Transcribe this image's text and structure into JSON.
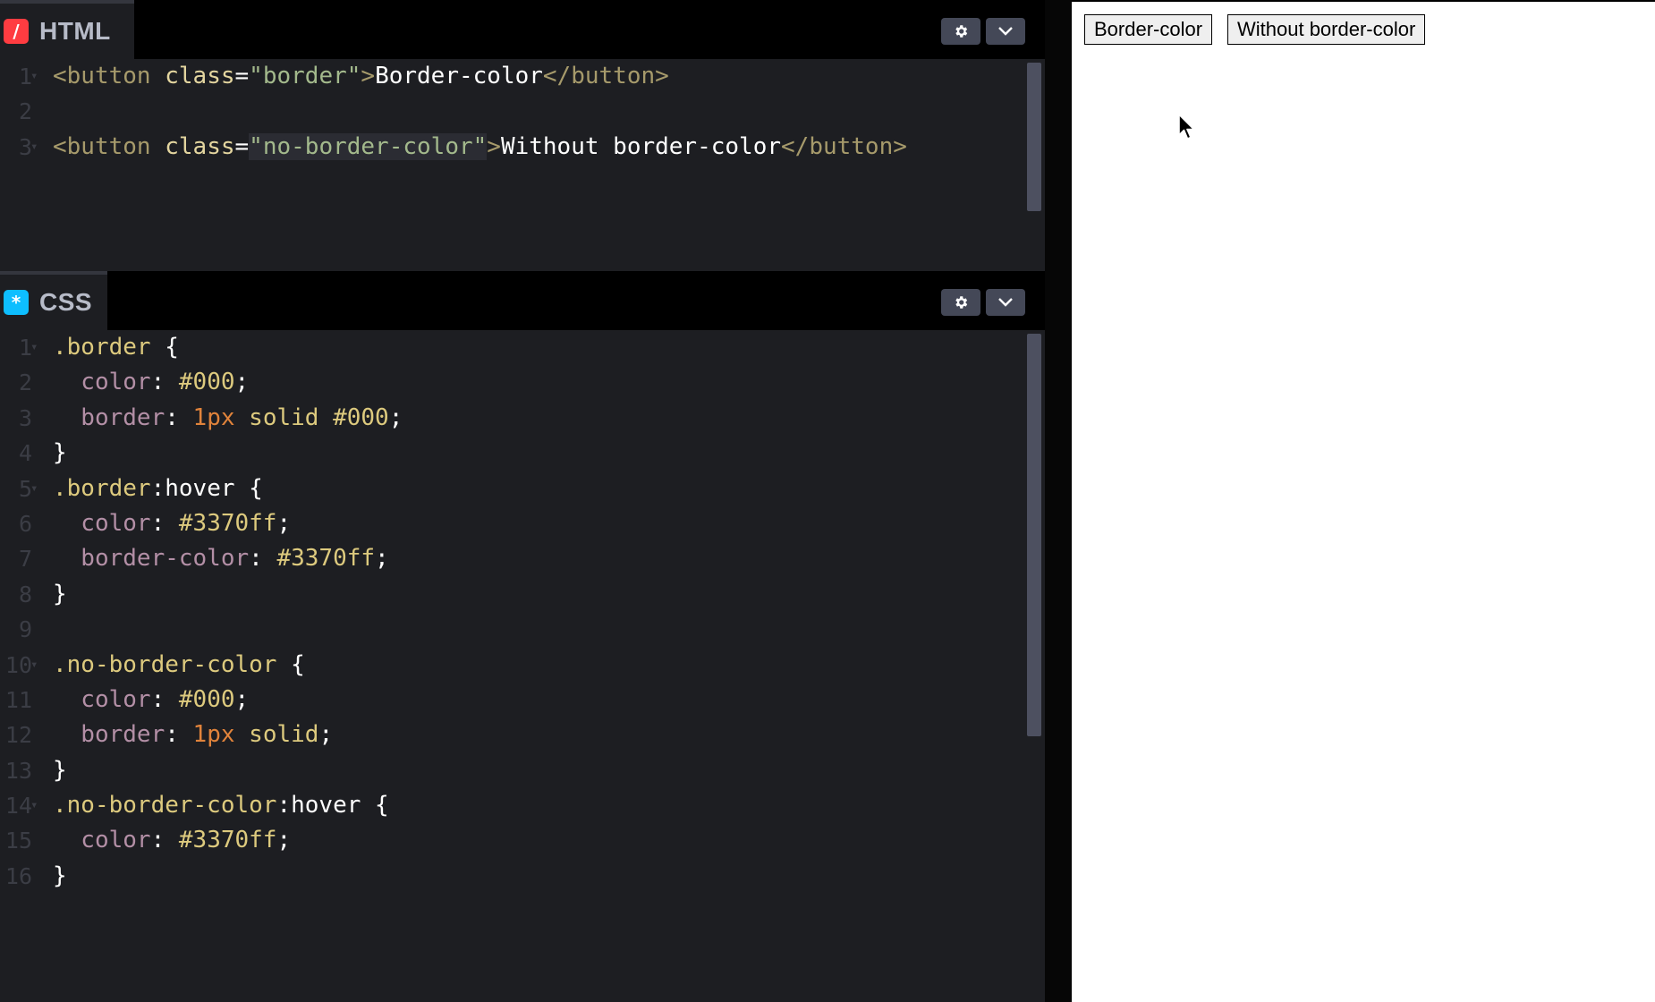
{
  "html_panel": {
    "title": "HTML",
    "icon": "/",
    "lines": [
      {
        "n": "1",
        "fold": true,
        "tokens": [
          {
            "t": "<button ",
            "c": "tag"
          },
          {
            "t": "class",
            "c": "attr"
          },
          {
            "t": "=",
            "c": "punc"
          },
          {
            "t": "\"border\"",
            "c": "str"
          },
          {
            "t": ">",
            "c": "tag"
          },
          {
            "t": "Border-color",
            "c": "txt"
          },
          {
            "t": "</button>",
            "c": "tag"
          }
        ]
      },
      {
        "n": "2",
        "fold": false,
        "tokens": []
      },
      {
        "n": "3",
        "fold": true,
        "tokens": [
          {
            "t": "<button ",
            "c": "tag"
          },
          {
            "t": "class",
            "c": "attr"
          },
          {
            "t": "=",
            "c": "punc"
          },
          {
            "t": "\"no-border-color\"",
            "c": "str",
            "hl": true
          },
          {
            "t": ">",
            "c": "tag"
          },
          {
            "t": "Without border-color",
            "c": "txt"
          },
          {
            "t": "</button>",
            "c": "tag"
          }
        ]
      }
    ]
  },
  "css_panel": {
    "title": "CSS",
    "icon": "*",
    "lines": [
      {
        "n": "1",
        "fold": true,
        "tokens": [
          {
            "t": ".border",
            "c": "sel"
          },
          {
            "t": " {",
            "c": "punc"
          }
        ]
      },
      {
        "n": "2",
        "fold": false,
        "tokens": [
          {
            "t": "  color",
            "c": "prop"
          },
          {
            "t": ": ",
            "c": "punc"
          },
          {
            "t": "#000",
            "c": "val"
          },
          {
            "t": ";",
            "c": "punc"
          }
        ]
      },
      {
        "n": "3",
        "fold": false,
        "tokens": [
          {
            "t": "  border",
            "c": "prop"
          },
          {
            "t": ": ",
            "c": "punc"
          },
          {
            "t": "1px",
            "c": "num"
          },
          {
            "t": " solid ",
            "c": "val"
          },
          {
            "t": "#000",
            "c": "val"
          },
          {
            "t": ";",
            "c": "punc"
          }
        ]
      },
      {
        "n": "4",
        "fold": false,
        "tokens": [
          {
            "t": "}",
            "c": "punc"
          }
        ]
      },
      {
        "n": "5",
        "fold": true,
        "tokens": [
          {
            "t": ".border",
            "c": "sel"
          },
          {
            "t": ":hover {",
            "c": "punc"
          }
        ]
      },
      {
        "n": "6",
        "fold": false,
        "tokens": [
          {
            "t": "  color",
            "c": "prop"
          },
          {
            "t": ": ",
            "c": "punc"
          },
          {
            "t": "#3370ff",
            "c": "val"
          },
          {
            "t": ";",
            "c": "punc"
          }
        ]
      },
      {
        "n": "7",
        "fold": false,
        "tokens": [
          {
            "t": "  border-color",
            "c": "prop"
          },
          {
            "t": ": ",
            "c": "punc"
          },
          {
            "t": "#3370ff",
            "c": "val"
          },
          {
            "t": ";",
            "c": "punc"
          }
        ]
      },
      {
        "n": "8",
        "fold": false,
        "tokens": [
          {
            "t": "}",
            "c": "punc"
          }
        ]
      },
      {
        "n": "9",
        "fold": false,
        "tokens": []
      },
      {
        "n": "10",
        "fold": true,
        "tokens": [
          {
            "t": ".no-border-color",
            "c": "sel"
          },
          {
            "t": " {",
            "c": "punc"
          }
        ]
      },
      {
        "n": "11",
        "fold": false,
        "tokens": [
          {
            "t": "  color",
            "c": "prop"
          },
          {
            "t": ": ",
            "c": "punc"
          },
          {
            "t": "#000",
            "c": "val"
          },
          {
            "t": ";",
            "c": "punc"
          }
        ]
      },
      {
        "n": "12",
        "fold": false,
        "tokens": [
          {
            "t": "  border",
            "c": "prop"
          },
          {
            "t": ": ",
            "c": "punc"
          },
          {
            "t": "1px",
            "c": "num"
          },
          {
            "t": " solid",
            "c": "val"
          },
          {
            "t": ";",
            "c": "punc"
          }
        ]
      },
      {
        "n": "13",
        "fold": false,
        "tokens": [
          {
            "t": "}",
            "c": "punc"
          }
        ]
      },
      {
        "n": "14",
        "fold": true,
        "tokens": [
          {
            "t": ".no-border-color",
            "c": "sel"
          },
          {
            "t": ":hover {",
            "c": "punc"
          }
        ]
      },
      {
        "n": "15",
        "fold": false,
        "tokens": [
          {
            "t": "  color",
            "c": "prop"
          },
          {
            "t": ": ",
            "c": "punc"
          },
          {
            "t": "#3370ff",
            "c": "val"
          },
          {
            "t": ";",
            "c": "punc"
          }
        ]
      },
      {
        "n": "16",
        "fold": false,
        "tokens": [
          {
            "t": "}",
            "c": "punc"
          }
        ]
      }
    ]
  },
  "result": {
    "button_border": "Border-color",
    "button_no_border": "Without border-color"
  },
  "icons": {
    "settings": "gear-icon",
    "collapse": "chevron-down-icon",
    "pointer": "mouse-pointer-icon"
  },
  "colors": {
    "accent_blue": "#3370ff",
    "html_badge": "#ff3c41",
    "css_badge": "#0ebeff"
  }
}
